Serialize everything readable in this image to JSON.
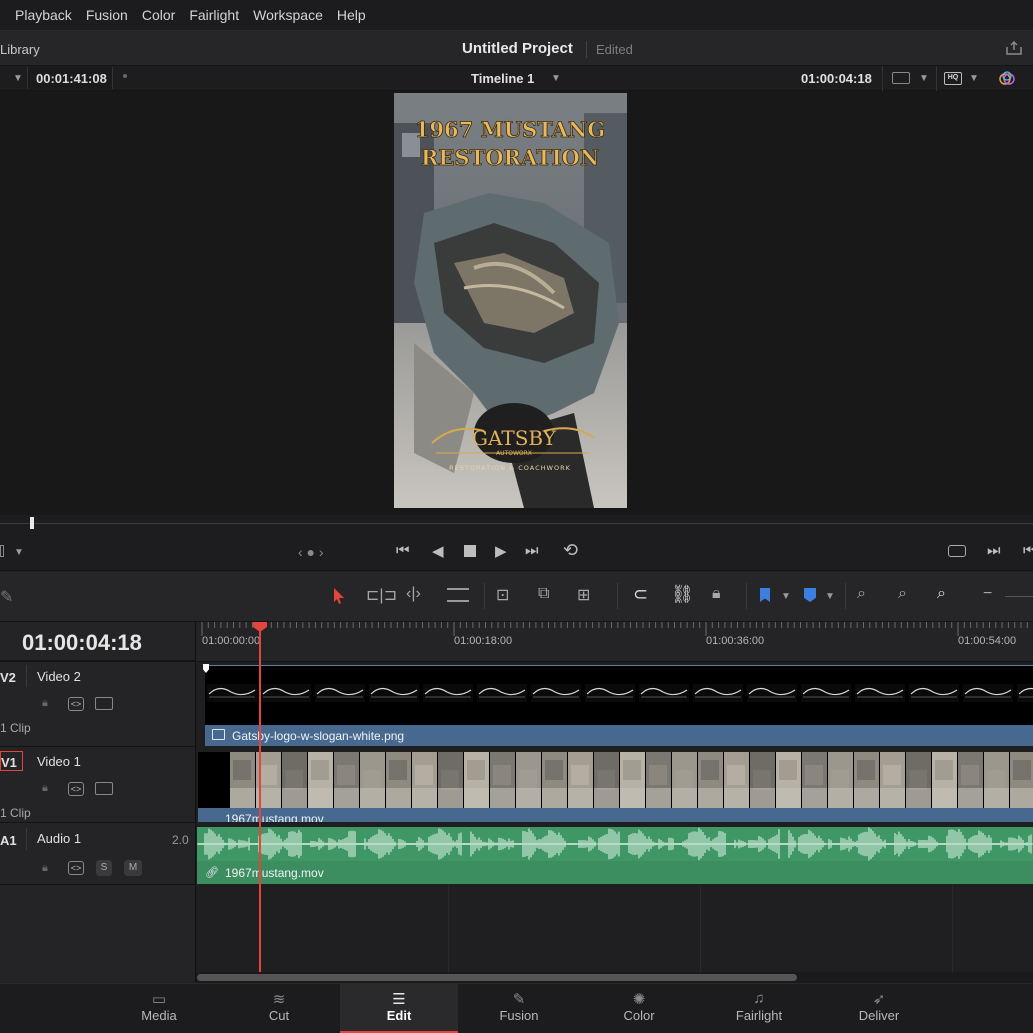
{
  "menu": [
    "Playback",
    "Fusion",
    "Color",
    "Fairlight",
    "Workspace",
    "Help"
  ],
  "header": {
    "library_label": "Library",
    "project_title": "Untitled Project",
    "project_status": "Edited"
  },
  "viewer": {
    "source_timecode": "00:01:41:08",
    "timeline_name": "Timeline 1",
    "record_timecode": "01:00:04:18",
    "overlay_title_line1": "1967 MUSTANG",
    "overlay_title_line2": "RESTORATION",
    "logo_text": "GATSBY",
    "logo_sub": "AUTOWORX",
    "logo_slogan": "RESTORATION & COACHWORK"
  },
  "timeline": {
    "current_timecode": "01:00:04:18",
    "ruler_marks": [
      "01:00:00:00",
      "01:00:18:00",
      "01:00:36:00",
      "01:00:54:00"
    ],
    "tracks": [
      {
        "id": "V2",
        "name": "Video 2",
        "clip_count": "1 Clip",
        "clip_name": "Gatsby-logo-w-slogan-white.png"
      },
      {
        "id": "V1",
        "name": "Video 1",
        "clip_count": "1 Clip",
        "clip_name": "1967mustang.mov"
      },
      {
        "id": "A1",
        "name": "Audio 1",
        "channel": "2.0",
        "clip_name": "1967mustang.mov",
        "solo": "S",
        "mute": "M"
      }
    ]
  },
  "pages": [
    {
      "label": "Media",
      "icon": "media-icon"
    },
    {
      "label": "Cut",
      "icon": "cut-icon"
    },
    {
      "label": "Edit",
      "icon": "edit-icon",
      "active": true
    },
    {
      "label": "Fusion",
      "icon": "fusion-icon"
    },
    {
      "label": "Color",
      "icon": "color-icon"
    },
    {
      "label": "Fairlight",
      "icon": "fairlight-icon"
    },
    {
      "label": "Deliver",
      "icon": "deliver-icon"
    }
  ],
  "colors": {
    "playhead": "#e2453a",
    "video_clip": "#47698f",
    "audio_clip": "#3f9766"
  }
}
